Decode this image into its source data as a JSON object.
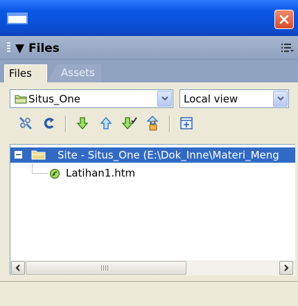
{
  "panel": {
    "title": "Files"
  },
  "tabs": [
    {
      "label": "Files",
      "active": true
    },
    {
      "label": "Assets",
      "active": false
    }
  ],
  "site_select": {
    "value": "Situs_One"
  },
  "view_select": {
    "value": "Local view"
  },
  "toolbar": {
    "icons": [
      "connect-icon",
      "refresh-icon",
      "get-files-icon",
      "put-files-icon",
      "check-out-icon",
      "check-in-icon",
      "expand-icon"
    ]
  },
  "tree": {
    "site_label": "Site - Situs_One (E:\\Dok_Inne\\Materi_Meng",
    "file_label": "Latihan1.htm"
  },
  "colors": {
    "titlebar": "#0b58e6",
    "selection": "#316ac5",
    "close": "#d94a2a"
  }
}
